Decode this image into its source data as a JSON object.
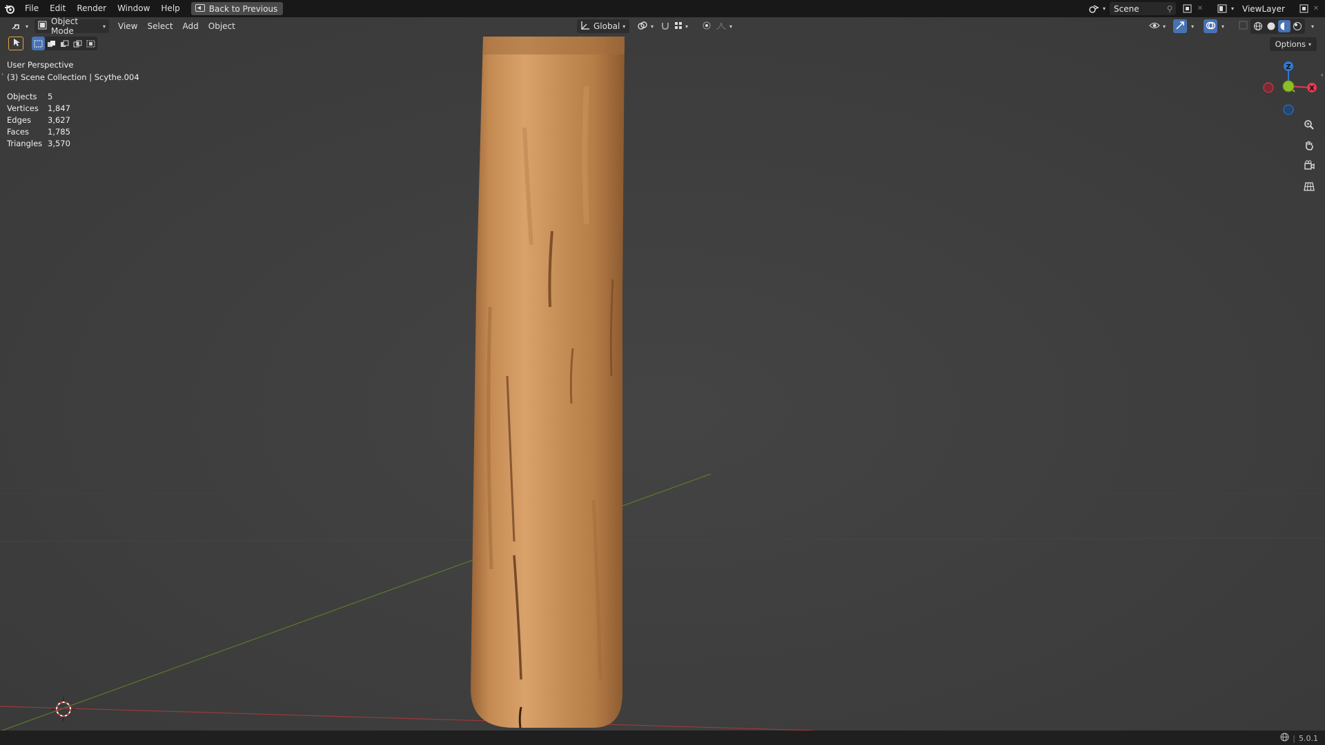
{
  "menubar": {
    "items": [
      "File",
      "Edit",
      "Render",
      "Window",
      "Help"
    ],
    "back_button": "Back to Previous",
    "scene": "Scene",
    "view_layer": "ViewLayer"
  },
  "viewport_header": {
    "mode": "Object Mode",
    "menus": [
      "View",
      "Select",
      "Add",
      "Object"
    ],
    "transform_orientation": "Global",
    "options": "Options"
  },
  "overlay": {
    "view_name": "User Perspective",
    "collection": "(3) Scene Collection | Scythe.004"
  },
  "stats": [
    {
      "label": "Objects",
      "value": "5"
    },
    {
      "label": "Vertices",
      "value": "1,847"
    },
    {
      "label": "Edges",
      "value": "3,627"
    },
    {
      "label": "Faces",
      "value": "1,785"
    },
    {
      "label": "Triangles",
      "value": "3,570"
    }
  ],
  "gizmo": {
    "z": "Z",
    "x": "X",
    "colors": {
      "x": "#e8384f",
      "y": "#8cbe28",
      "z": "#2e7ad6"
    }
  },
  "statusbar": {
    "version": "5.0.1"
  },
  "colors": {
    "viewport_bg": "#3d3d3d",
    "accent": "#4772b3",
    "wood_light": "#c98f57",
    "wood_dark": "#8a5730"
  },
  "icons": [
    "blender-logo-icon",
    "back-icon",
    "editor-type-icon",
    "object-mode-icon",
    "global-icon",
    "pivot-icon",
    "snap-icon",
    "proportional-icon",
    "visibility-icon",
    "gizmo-icon",
    "overlay-icon",
    "xray-icon",
    "wireframe-shading-icon",
    "solid-shading-icon",
    "material-shading-icon",
    "rendered-shading-icon",
    "zoom-icon",
    "hand-icon",
    "camera-icon",
    "grid-icon",
    "globe-icon"
  ]
}
